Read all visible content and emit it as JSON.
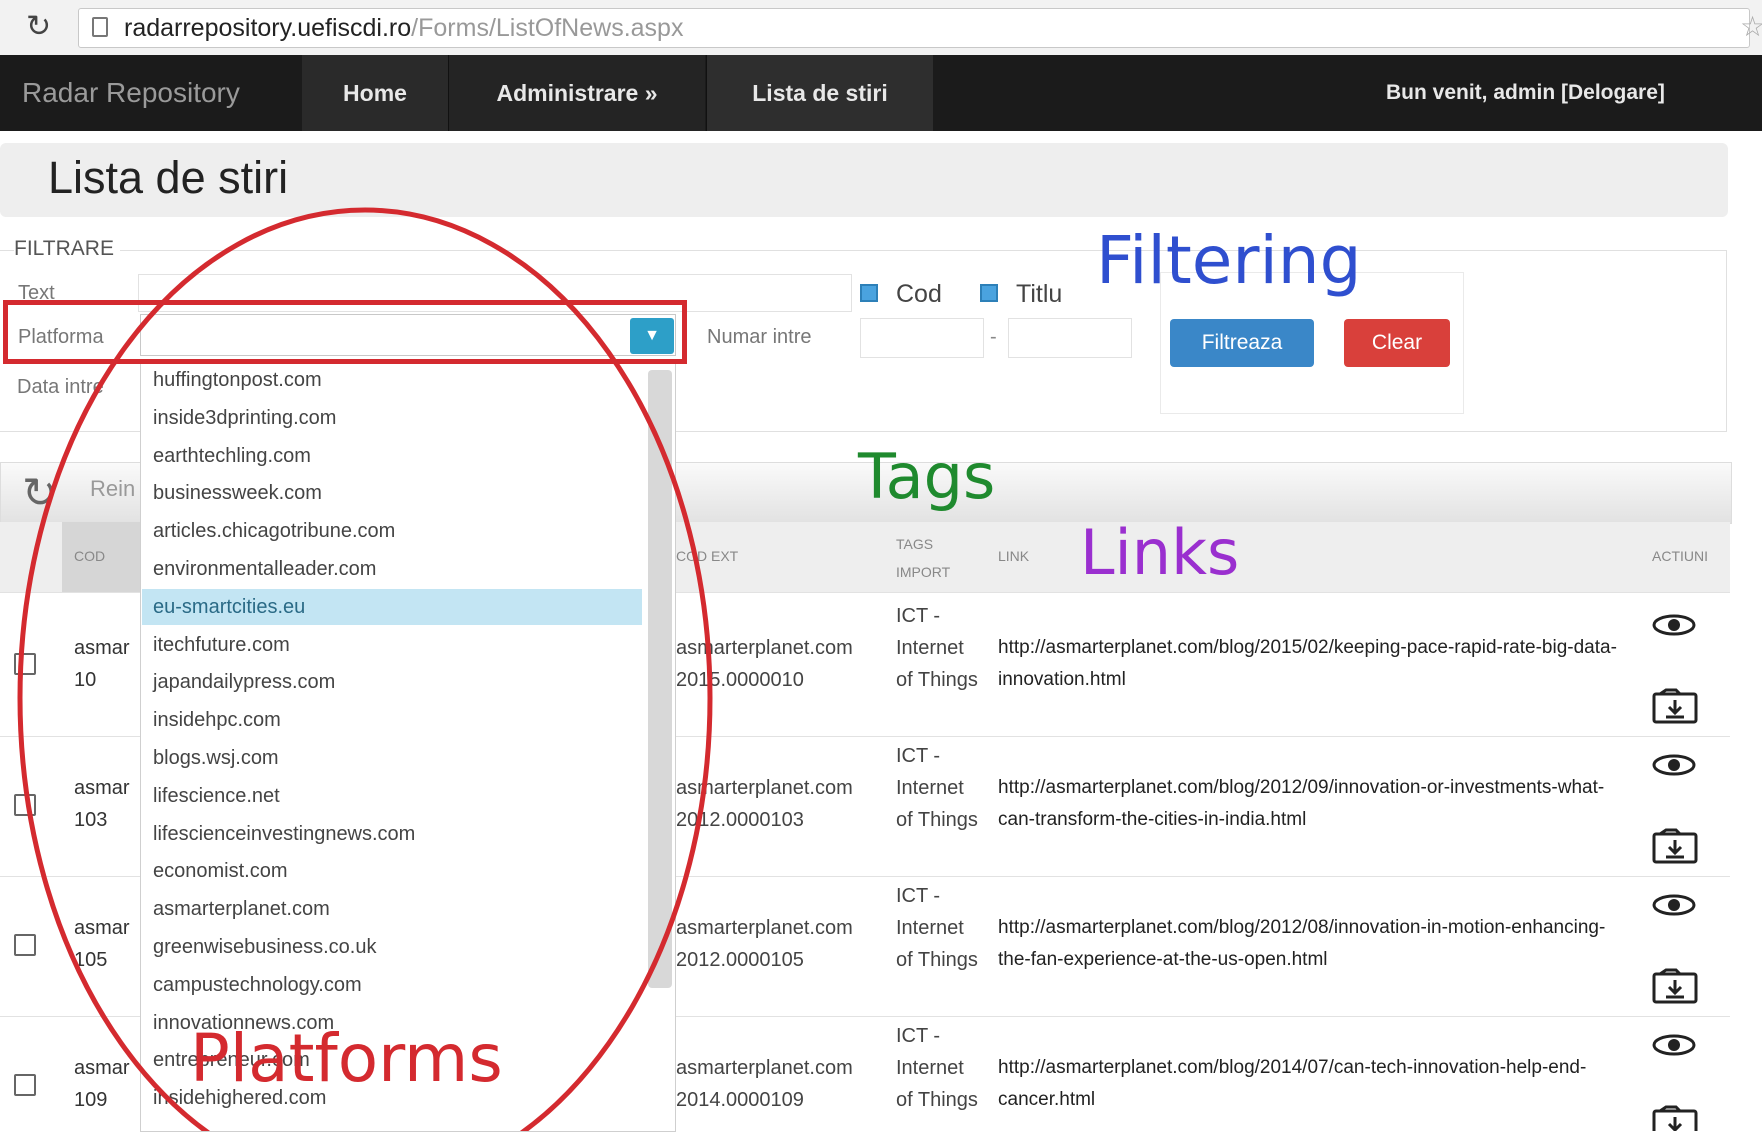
{
  "browser": {
    "url_host": "radarrepository.uefiscdi.ro",
    "url_path": "/Forms/ListOfNews.aspx"
  },
  "navbar": {
    "brand": "Radar Repository",
    "items": [
      {
        "label": "Home"
      },
      {
        "label": "Administrare »"
      },
      {
        "label": "Lista de stiri"
      }
    ],
    "welcome": "Bun venit, admin [Delogare]"
  },
  "page": {
    "title": "Lista de stiri"
  },
  "filter": {
    "legend": "FILTRARE",
    "text_label": "Text",
    "platform_label": "Platforma",
    "date_label": "Data intre",
    "cod_label": "Cod",
    "titlu_label": "Titlu",
    "numar_label": "Numar intre",
    "dash": "-",
    "filter_button": "Filtreaza",
    "clear_button": "Clear"
  },
  "dropdown": {
    "options": [
      "huffingtonpost.com",
      "inside3dprinting.com",
      "earthtechling.com",
      "businessweek.com",
      "articles.chicagotribune.com",
      "environmentalleader.com",
      "eu-smartcities.eu",
      "itechfuture.com",
      "japandailypress.com",
      "insidehpc.com",
      "blogs.wsj.com",
      "lifescience.net",
      "lifescienceinvestingnews.com",
      "economist.com",
      "asmarterplanet.com",
      "greenwisebusiness.co.uk",
      "campustechnology.com",
      "innovationnews.com",
      "entrepreneur.com",
      "insidehighered.com"
    ],
    "selected": "eu-smartcities.eu"
  },
  "table": {
    "toolbar_text": "Rein",
    "headers": {
      "cod": "COD",
      "cod_ext": "COD EXT",
      "tags": "TAGS IMPORT",
      "link": "LINK",
      "action": "ACTIUNI"
    },
    "rows": [
      {
        "cod_line1": "asmar",
        "cod_line2": "10",
        "ext_line1": "asmarterplanet.com",
        "ext_line2": "2015.0000010",
        "tags": "ICT - Internet of Things",
        "link": "http://asmarterplanet.com/blog/2015/02/keeping-pace-rapid-rate-big-data-innovation.html"
      },
      {
        "cod_line1": "asmar",
        "cod_line2": "103",
        "ext_line1": "asmarterplanet.com",
        "ext_line2": "2012.0000103",
        "tags": "ICT - Internet of Things",
        "link": "http://asmarterplanet.com/blog/2012/09/innovation-or-investments-what-can-transform-the-cities-in-india.html"
      },
      {
        "cod_line1": "asmar",
        "cod_line2": "105",
        "ext_line1": "asmarterplanet.com",
        "ext_line2": "2012.0000105",
        "tags": "ICT - Internet of Things",
        "link": "http://asmarterplanet.com/blog/2012/08/innovation-in-motion-enhancing-the-fan-experience-at-the-us-open.html"
      },
      {
        "cod_line1": "asmar",
        "cod_line2": "109",
        "ext_line1": "asmarterplanet.com",
        "ext_line2": "2014.0000109",
        "tags": "ICT - Internet of Things",
        "link": "http://asmarterplanet.com/blog/2014/07/can-tech-innovation-help-end-cancer.html"
      }
    ]
  },
  "annotations": {
    "filtering": "Filtering",
    "tags": "Tags",
    "links": "Links",
    "platforms": "Platforms",
    "colors": {
      "red": "#d42a2f",
      "blue": "#2f4fcf",
      "green": "#1f8a2e",
      "purple": "#9a2fcf"
    }
  }
}
